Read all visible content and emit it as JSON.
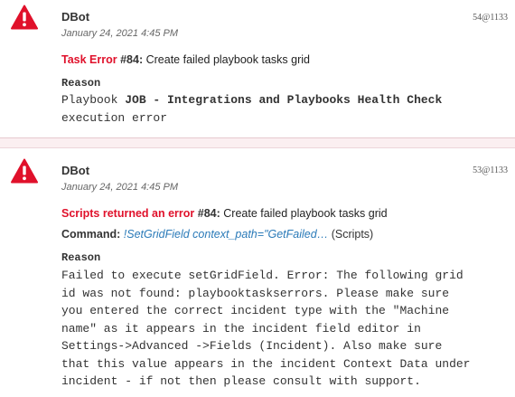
{
  "colors": {
    "error_red": "#e0112b",
    "link_blue": "#2a7ab8",
    "divider_bg": "#fbeff1"
  },
  "entries": [
    {
      "icon": "warning-icon",
      "author": "DBot",
      "timestamp": "January 24, 2021 4:45 PM",
      "entry_id": "54@1133",
      "error_type": "Task Error",
      "task_number": "#84:",
      "task_name": "Create failed playbook tasks grid",
      "reason_label": "Reason",
      "reason_prefix": "Playbook ",
      "reason_bold": "JOB - Integrations and Playbooks Health Check",
      "reason_suffix": "execution error"
    },
    {
      "icon": "warning-icon",
      "author": "DBot",
      "timestamp": "January 24, 2021 4:45 PM",
      "entry_id": "53@1133",
      "error_type": "Scripts returned an error",
      "task_number": "#84:",
      "task_name": "Create failed playbook tasks grid",
      "command_label": "Command:",
      "command_text": "!SetGridField context_path=\"GetFailed…",
      "command_suffix": "(Scripts)",
      "reason_label": "Reason",
      "reason_text": "Failed to execute setGridField. Error: The following grid\nid was not found: playbooktaskserrors. Please make sure\nyou entered the correct incident type with the \"Machine\nname\" as it appears in the incident field editor in\nSettings->Advanced ->Fields (Incident). Also make sure\nthat this value appears in the incident Context Data under\nincident - if not then please consult with support."
    }
  ]
}
